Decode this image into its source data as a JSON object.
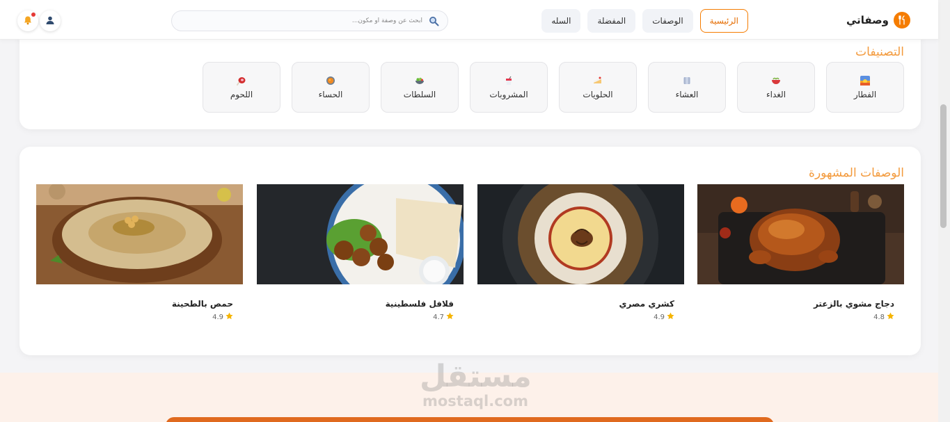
{
  "brand": {
    "name": "وصفاتي",
    "logo_icon": "fork-knife-icon",
    "accent": "#f57c00"
  },
  "nav": {
    "items": [
      {
        "label": "الرئيسية",
        "active": true
      },
      {
        "label": "الوصفات",
        "active": false
      },
      {
        "label": "المفضلة",
        "active": false
      },
      {
        "label": "السله",
        "active": false
      }
    ]
  },
  "search": {
    "placeholder": "ابحث عن وصفة أو مكون..."
  },
  "header_icons": [
    "user-icon",
    "bell-icon"
  ],
  "categories": {
    "title": "التصنيفات",
    "items": [
      {
        "label": "الفطار",
        "icon": "sunrise-icon"
      },
      {
        "label": "الغداء",
        "icon": "bowl-icon"
      },
      {
        "label": "العشاء",
        "icon": "plate-icon"
      },
      {
        "label": "الحلويات",
        "icon": "cake-icon"
      },
      {
        "label": "المشروبات",
        "icon": "drink-icon"
      },
      {
        "label": "السلطات",
        "icon": "salad-icon"
      },
      {
        "label": "الحساء",
        "icon": "soup-icon"
      },
      {
        "label": "اللحوم",
        "icon": "meat-icon"
      }
    ]
  },
  "popular": {
    "title": "الوصفات المشهورة",
    "recipes": [
      {
        "name": "دجاج مشوي بالزعتر",
        "rating": "4.8"
      },
      {
        "name": "كشري مصري",
        "rating": "4.9"
      },
      {
        "name": "فلافل فلسطينية",
        "rating": "4.7"
      },
      {
        "name": "حمص بالطحينة",
        "rating": "4.9"
      }
    ]
  },
  "watermark": {
    "arabic": "مستقل",
    "latin": "mostaql.com"
  }
}
